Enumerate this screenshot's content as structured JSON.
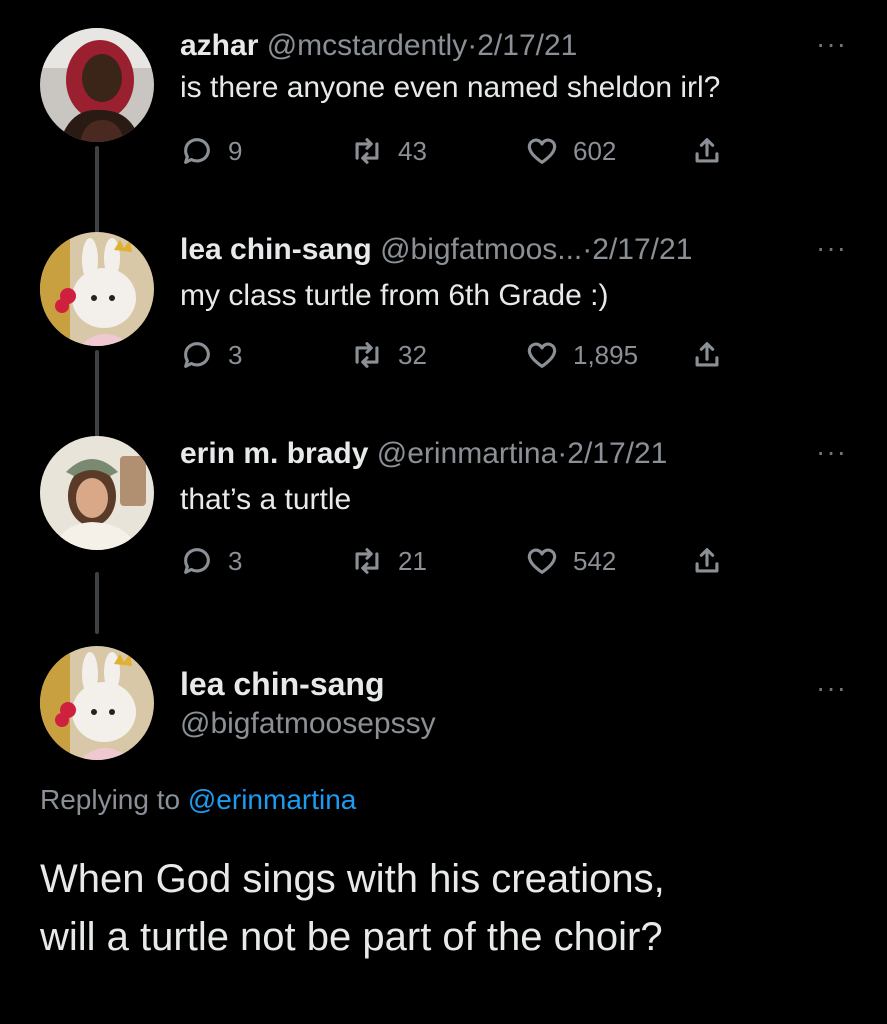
{
  "thread": [
    {
      "name": "azhar",
      "handle": "@mcstardently",
      "separator": "·",
      "date": "2/17/21",
      "text": "is there anyone even named sheldon irl?",
      "replies": "9",
      "retweets": "43",
      "likes": "602"
    },
    {
      "name": "lea chin-sang",
      "handle": "@bigfatmoos...",
      "separator": "·",
      "date": "2/17/21",
      "text": "my class turtle from 6th Grade :)",
      "replies": "3",
      "retweets": "32",
      "likes": "1,895"
    },
    {
      "name": "erin m. brady",
      "handle": "@erinmartina",
      "separator": "·",
      "date": "2/17/21",
      "text": "that’s a turtle",
      "replies": "3",
      "retweets": "21",
      "likes": "542"
    }
  ],
  "focus_tweet": {
    "name": "lea chin-sang",
    "handle": "@bigfatmoosepssy",
    "replying_prefix": "Replying to",
    "replying_to": "@erinmartina",
    "text_line1": "When God sings with his creations,",
    "text_line2": "will a turtle not be part of the choir?"
  },
  "more_label": "···",
  "icons": [
    "reply-icon",
    "retweet-icon",
    "like-icon",
    "share-icon",
    "more-icon"
  ],
  "colors": {
    "background": "#000000",
    "text": "#e7e9ea",
    "muted": "#8b9096",
    "link": "#1d9bf0"
  }
}
